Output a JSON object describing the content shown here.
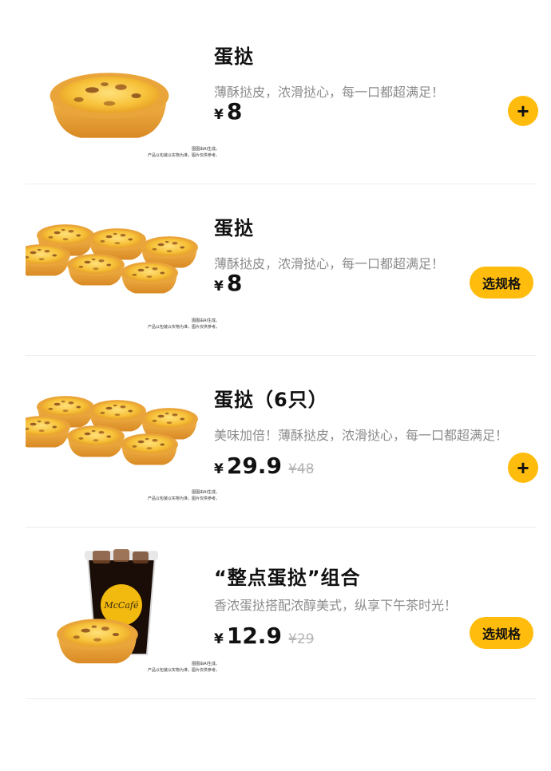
{
  "items": [
    {
      "title": "蛋挞",
      "description": "薄酥挞皮，浓滑挞心，每一口都超满足！",
      "currency": "¥",
      "price": "8",
      "original_price": "",
      "action": "+",
      "image": "single-egg-tart",
      "disclaimer_1": "图图由AI生成。",
      "disclaimer_2": "产品以包装以实物为准，图片仅供参考。"
    },
    {
      "title": "蛋挞",
      "description": "薄酥挞皮，浓滑挞心，每一口都超满足！",
      "currency": "¥",
      "price": "8",
      "original_price": "",
      "action": "选规格",
      "image": "six-egg-tarts",
      "disclaimer_1": "图图由AI生成。",
      "disclaimer_2": "产品以包装以实物为准，图片仅供参考。"
    },
    {
      "title": "蛋挞（6只）",
      "description": "美味加倍！薄酥挞皮，浓滑挞心，每一口都超满足！",
      "currency": "¥",
      "price": "29.9",
      "original_price": "¥48",
      "action": "+",
      "image": "six-egg-tarts",
      "disclaimer_1": "图图由AI生成。",
      "disclaimer_2": "产品以包装以实物为准，图片仅供参考。"
    },
    {
      "title": "“整点蛋挞”组合",
      "description": "香浓蛋挞搭配浓醇美式，纵享下午茶时光！",
      "currency": "¥",
      "price": "12.9",
      "original_price": "¥29",
      "action": "选规格",
      "image": "egg-tart-with-iced-coffee",
      "cup_logo": "McCafé",
      "disclaimer_1": "图图由AI生成。",
      "disclaimer_2": "产品以包装以实物为准，图片仅供参考。"
    }
  ],
  "colors": {
    "accent": "#ffbc0d",
    "muted_text": "#8c8c8c",
    "strike_text": "#b3b3b3"
  }
}
